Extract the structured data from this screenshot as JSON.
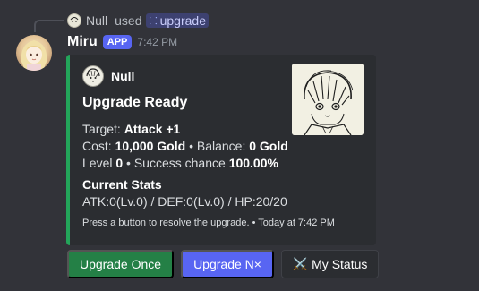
{
  "reply": {
    "user": "Null",
    "used_text": "used",
    "command": "upgrade"
  },
  "message": {
    "author": "Miru",
    "badge": "APP",
    "time": "7:42 PM"
  },
  "embed": {
    "accent_color": "#23a55a",
    "author_name": "Null",
    "title": "Upgrade Ready",
    "target_label": "Target:",
    "target_value": "Attack +1",
    "cost_label": "Cost:",
    "cost_value": "10,000 Gold",
    "balance_label": "Balance:",
    "balance_value": "0 Gold",
    "level_label": "Level",
    "level_value": "0",
    "success_label": "Success chance",
    "success_value": "100.00%",
    "field_name": "Current Stats",
    "field_value": "ATK:0(Lv.0) / DEF:0(Lv.0) / HP:20/20",
    "footer_text": "Press a button to resolve the upgrade.",
    "footer_time": "Today at 7:42 PM"
  },
  "buttons": {
    "upgrade_once": "Upgrade Once",
    "upgrade_n": "Upgrade N×",
    "my_status": "My Status"
  },
  "colors": {
    "background": "#323339",
    "embed_bg": "#2b2d31",
    "green_button": "#248046",
    "blurple_button": "#5865f2"
  }
}
